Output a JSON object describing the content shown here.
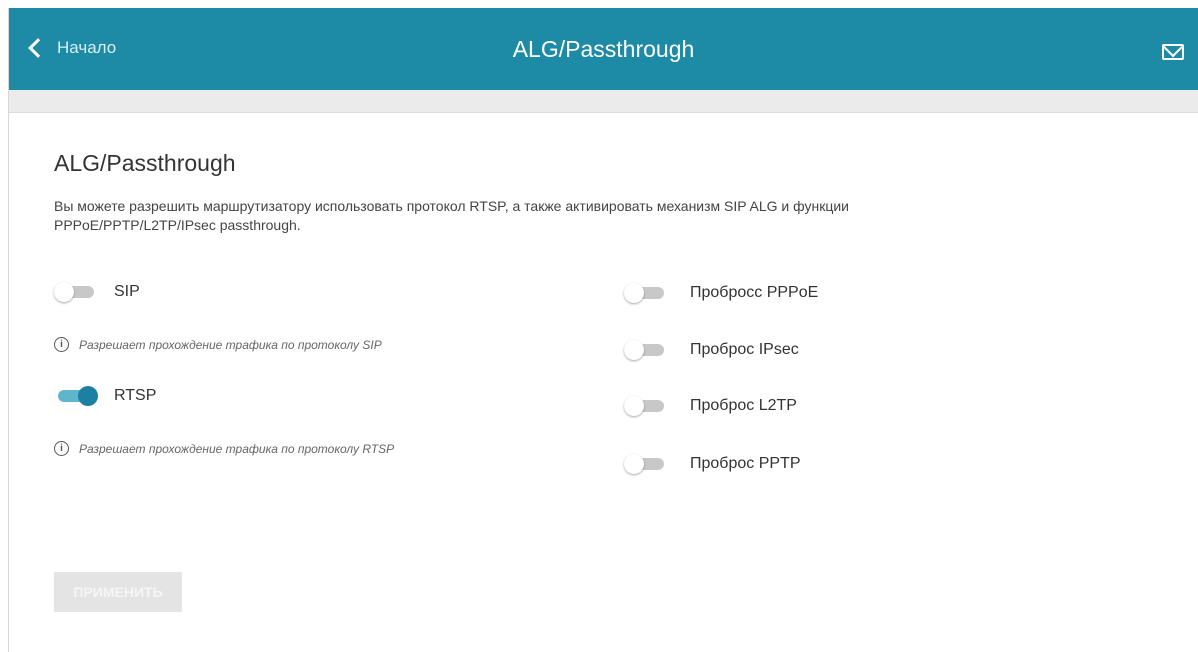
{
  "header": {
    "back_label": "Начало",
    "title": "ALG/Passthrough"
  },
  "content": {
    "heading": "ALG/Passthrough",
    "description": "Вы можете разрешить маршрутизатору использовать протокол RTSP, а также активировать механизм SIP ALG и функции PPPoE/PPTP/L2TP/IPsec passthrough."
  },
  "left_toggles": [
    {
      "label": "SIP",
      "enabled": false,
      "hint": "Разрешает прохождение трафика по протоколу SIP"
    },
    {
      "label": "RTSP",
      "enabled": true,
      "hint": "Разрешает прохождение трафика по протоколу RTSP"
    }
  ],
  "right_toggles": [
    {
      "label": "Пробросс PPPoE",
      "enabled": false
    },
    {
      "label": "Проброс IPsec",
      "enabled": false
    },
    {
      "label": "Проброс L2TP",
      "enabled": false
    },
    {
      "label": "Проброс PPTP",
      "enabled": false
    }
  ],
  "apply_button": {
    "label": "ПРИМЕНИТЬ",
    "disabled": true
  },
  "colors": {
    "accent": "#1d8aa6",
    "toggle_on": "#1d7fa2"
  }
}
